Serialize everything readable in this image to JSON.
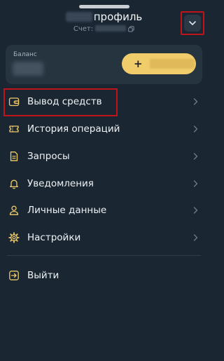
{
  "header": {
    "title_suffix": "профиль",
    "account_label": "Счет:"
  },
  "balance": {
    "label": "Баланс",
    "deposit_symbol": "+"
  },
  "menu": {
    "items": [
      {
        "label": "Вывод средств",
        "icon": "wallet-icon"
      },
      {
        "label": "История операций",
        "icon": "ticket-icon"
      },
      {
        "label": "Запросы",
        "icon": "document-icon"
      },
      {
        "label": "Уведомления",
        "icon": "bell-icon"
      },
      {
        "label": "Личные данные",
        "icon": "user-icon"
      },
      {
        "label": "Настройки",
        "icon": "gear-icon"
      }
    ],
    "logout_label": "Выйти"
  },
  "colors": {
    "background": "#1a2733",
    "accent": "#f0cc6b",
    "highlight": "#c0141a"
  }
}
